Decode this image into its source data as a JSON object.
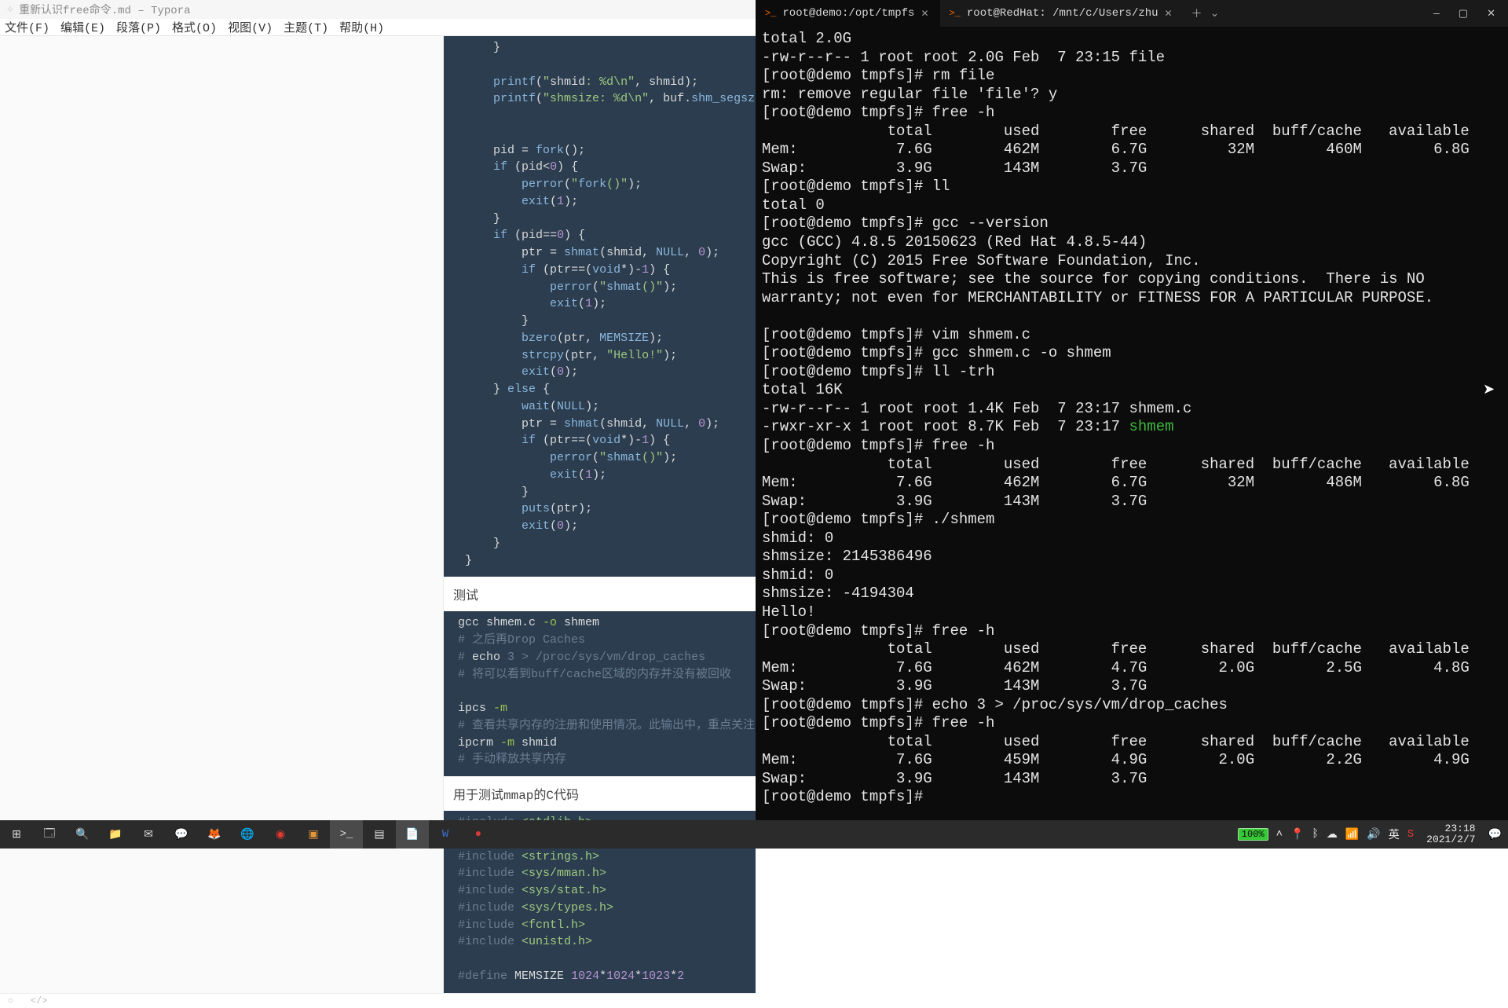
{
  "typora": {
    "title": "重新认识free命令.md – Typora",
    "menu": [
      "文件(F)",
      "编辑(E)",
      "段落(P)",
      "格式(O)",
      "视图(V)",
      "主题(T)",
      "帮助(H)"
    ],
    "code1": "     }\n\n     printf(\"shmid: %d\\n\", shmid);\n     printf(\"shmsize: %d\\n\", buf.shm_segsz);\n\n\n     pid = fork();\n     if (pid<0) {\n         perror(\"fork()\");\n         exit(1);\n     }\n     if (pid==0) {\n         ptr = shmat(shmid, NULL, 0);\n         if (ptr==(void*)-1) {\n             perror(\"shmat()\");\n             exit(1);\n         }\n         bzero(ptr, MEMSIZE);\n         strcpy(ptr, \"Hello!\");\n         exit(0);\n     } else {\n         wait(NULL);\n         ptr = shmat(shmid, NULL, 0);\n         if (ptr==(void*)-1) {\n             perror(\"shmat()\");\n             exit(1);\n         }\n         puts(ptr);\n         exit(0);\n     }\n }",
    "heading_test": "测试",
    "shell1": "gcc shmem.c -o shmem\n# 之后再Drop Caches\n# echo 3 > /proc/sys/vm/drop_caches\n# 将可以看到buff/cache区域的内存并没有被回收\n\nipcs -m\n# 查看共享内存的注册和使用情况。此输出中，重点关注shmid和字\nipcrm -m shmid\n# 手动释放共享内存",
    "heading_mmap": "用于测试mmap的C代码",
    "code2": "#include <stdlib.h>\n#include <stdio.h>\n#include <strings.h>\n#include <sys/mman.h>\n#include <sys/stat.h>\n#include <sys/types.h>\n#include <fcntl.h>\n#include <unistd.h>\n\n#define MEMSIZE 1024*1024*1023*2"
  },
  "terminal": {
    "tabs": [
      {
        "label": "root@demo:/opt/tmpfs",
        "active": true
      },
      {
        "label": "root@RedHat: /mnt/c/Users/zhu",
        "active": false
      }
    ],
    "lines": [
      "total 2.0G",
      "-rw-r--r-- 1 root root 2.0G Feb  7 23:15 file",
      "[root@demo tmpfs]# rm file",
      "rm: remove regular file 'file'? y",
      "[root@demo tmpfs]# free -h",
      "              total        used        free      shared  buff/cache   available",
      "Mem:           7.6G        462M        6.7G         32M        460M        6.8G",
      "Swap:          3.9G        143M        3.7G",
      "[root@demo tmpfs]# ll",
      "total 0",
      "[root@demo tmpfs]# gcc --version",
      "gcc (GCC) 4.8.5 20150623 (Red Hat 4.8.5-44)",
      "Copyright (C) 2015 Free Software Foundation, Inc.",
      "This is free software; see the source for copying conditions.  There is NO",
      "warranty; not even for MERCHANTABILITY or FITNESS FOR A PARTICULAR PURPOSE.",
      "",
      "[root@demo tmpfs]# vim shmem.c",
      "[root@demo tmpfs]# gcc shmem.c -o shmem",
      "[root@demo tmpfs]# ll -trh",
      "total 16K",
      "-rw-r--r-- 1 root root 1.4K Feb  7 23:17 shmem.c",
      {
        "pre": "-rwxr-xr-x 1 root root 8.7K Feb  7 23:17 ",
        "exe": "shmem"
      },
      "[root@demo tmpfs]# free -h",
      "              total        used        free      shared  buff/cache   available",
      "Mem:           7.6G        462M        6.7G         32M        486M        6.8G",
      "Swap:          3.9G        143M        3.7G",
      "[root@demo tmpfs]# ./shmem",
      "shmid: 0",
      "shmsize: 2145386496",
      "shmid: 0",
      "shmsize: -4194304",
      "Hello!",
      "[root@demo tmpfs]# free -h",
      "              total        used        free      shared  buff/cache   available",
      "Mem:           7.6G        462M        4.7G        2.0G        2.5G        4.8G",
      "Swap:          3.9G        143M        3.7G",
      "[root@demo tmpfs]# echo 3 > /proc/sys/vm/drop_caches",
      "[root@demo tmpfs]# free -h",
      "              total        used        free      shared  buff/cache   available",
      "Mem:           7.6G        459M        4.9G        2.0G        2.2G        4.9G",
      "Swap:          3.9G        143M        3.7G",
      "[root@demo tmpfs]# "
    ]
  },
  "taskbar": {
    "battery": "100%",
    "time": "23:18",
    "date": "2021/2/7",
    "ime": "英"
  }
}
